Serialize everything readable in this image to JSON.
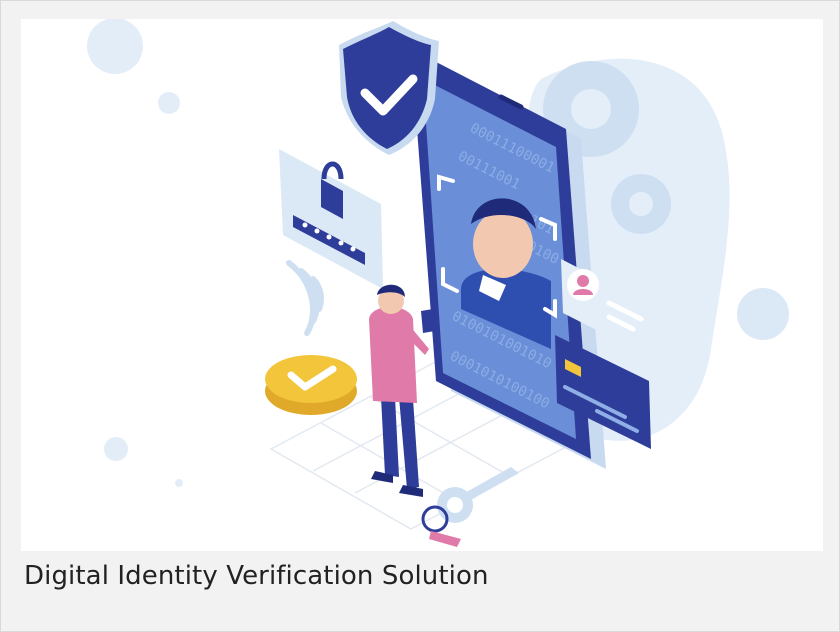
{
  "card": {
    "caption": "Digital Identity Verification Solution"
  },
  "illustration": {
    "subject": "isometric-phone-face-verification",
    "phone_screen_code": [
      "00011100001",
      "00111001",
      "0101",
      "0100",
      "0100101001010",
      "0001010100100"
    ]
  },
  "colors": {
    "card_background": "#f2f2f2",
    "image_background": "#ffffff",
    "navy": "#2f3d9a",
    "light_blue": "#dbe8f6",
    "pink": "#e07aa8",
    "yellow": "#f3c53b",
    "caption_text": "#222222"
  }
}
